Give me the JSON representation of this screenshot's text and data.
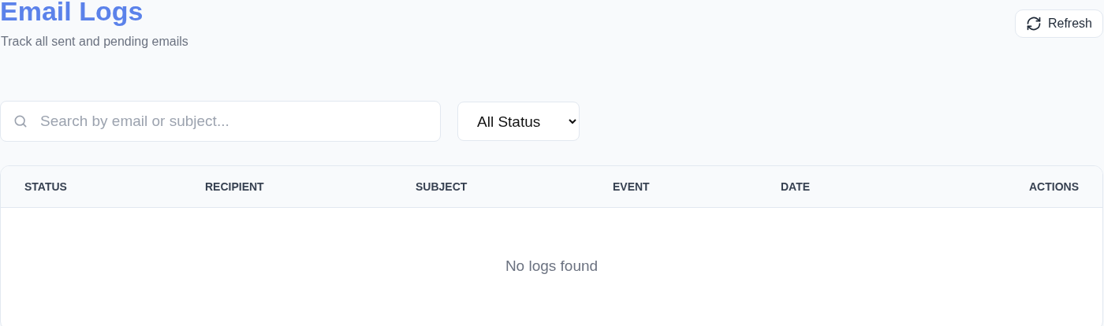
{
  "header": {
    "title": "Email Logs",
    "subtitle": "Track all sent and pending emails",
    "refresh_button": "Refresh"
  },
  "filters": {
    "search": {
      "placeholder": "Search by email or subject..."
    },
    "status_select": "All Status"
  },
  "table": {
    "columns": [
      "STATUS",
      "RECIPIENT",
      "SUBJECT",
      "EVENT",
      "DATE",
      "ACTIONS"
    ],
    "empty_message": "No logs found"
  }
}
